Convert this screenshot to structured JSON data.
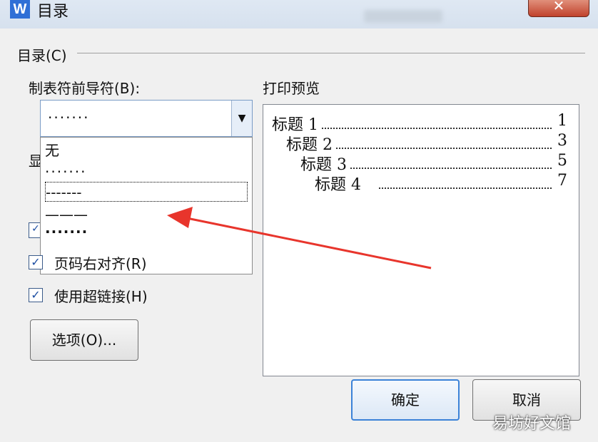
{
  "window": {
    "title": "目录",
    "app_icon": "W",
    "close": "✕"
  },
  "group": {
    "label": "目录(C)"
  },
  "leader": {
    "label": "制表符前导符(B):",
    "selected": "·······",
    "options": [
      "无",
      "·······",
      "-------",
      "———",
      "·······"
    ]
  },
  "hidden_label": "显",
  "checkboxes": [
    {
      "label": "页码右对齐(R)",
      "checked": true
    },
    {
      "label": "使用超链接(H)",
      "checked": true
    }
  ],
  "options_button": "选项(O)...",
  "preview": {
    "label": "打印预览",
    "lines": [
      {
        "text": "标题 1",
        "page": "1"
      },
      {
        "text": "标题 2",
        "page": "3"
      },
      {
        "text": "标题 3",
        "page": "5"
      },
      {
        "text": "标题 4",
        "page": "7"
      }
    ]
  },
  "buttons": {
    "ok": "确定",
    "cancel": "取消"
  },
  "watermark": "易坊好文馆",
  "colors": {
    "arrow": "#e8352c",
    "accent": "#3b82d8"
  }
}
